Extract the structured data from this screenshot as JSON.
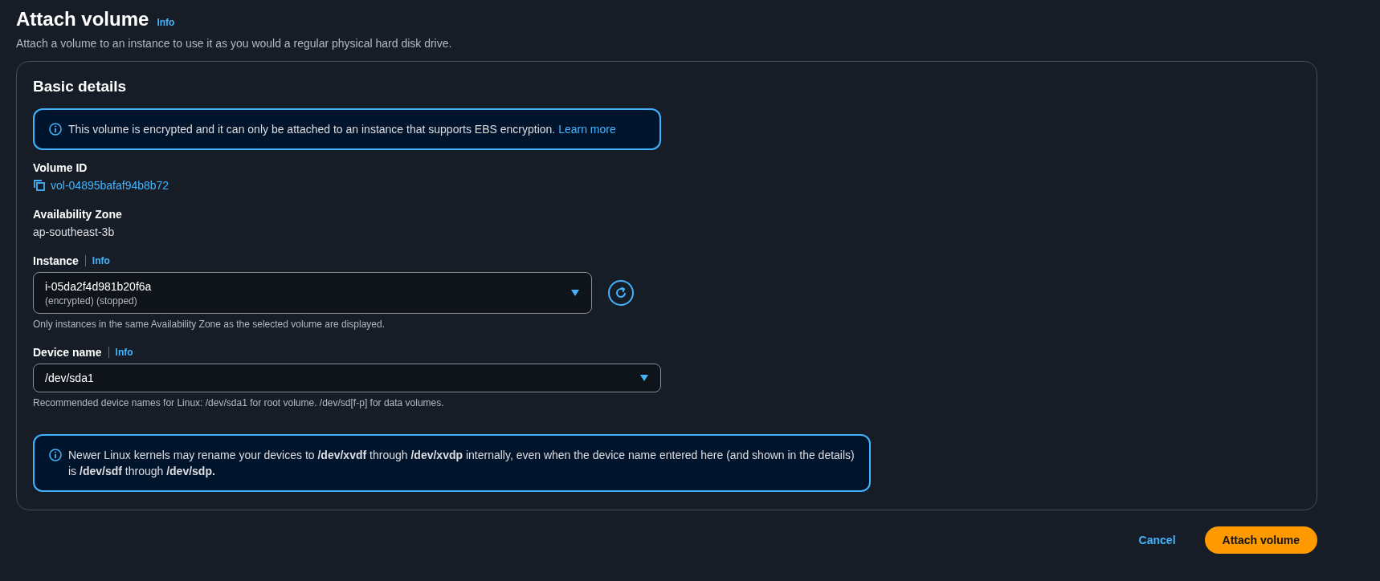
{
  "header": {
    "title": "Attach volume",
    "info": "Info",
    "description": "Attach a volume to an instance to use it as you would a regular physical hard disk drive."
  },
  "card": {
    "title": "Basic details",
    "items": [
      {
        "kind": "alert",
        "text": "This volume is encrypted and it can only be attached to an instance that supports EBS encryption.",
        "link": "Learn more",
        "wide": false
      },
      {
        "kind": "copyable",
        "label": "Volume ID",
        "value": "vol-04895bafaf94b8b72"
      },
      {
        "kind": "text",
        "label": "Availability Zone",
        "value": "ap-southeast-3b"
      },
      {
        "kind": "select",
        "label": "Instance",
        "info": "Info",
        "value": "i-05da2f4d981b20f6a",
        "secondary": "(encrypted) (stopped)",
        "hint": "Only instances in the same Availability Zone as the selected volume are displayed.",
        "refresh_button": true
      },
      {
        "kind": "select",
        "label": "Device name",
        "info": "Info",
        "value": "/dev/sda1",
        "hint": "Recommended device names for Linux: /dev/sda1 for root volume. /dev/sd[f-p] for data volumes.",
        "refresh_button": false
      },
      {
        "kind": "alert",
        "text": "Newer Linux kernels may rename your devices to **/dev/xvdf** through **/dev/xvdp** internally, even when the device name entered here (and shown in the details) is **/dev/sdf** through **/dev/sdp.**",
        "wide": true
      }
    ]
  },
  "footer": {
    "buttons": [
      {
        "kind": "link",
        "label": "Cancel"
      },
      {
        "kind": "primary",
        "label": "Attach volume"
      }
    ]
  }
}
